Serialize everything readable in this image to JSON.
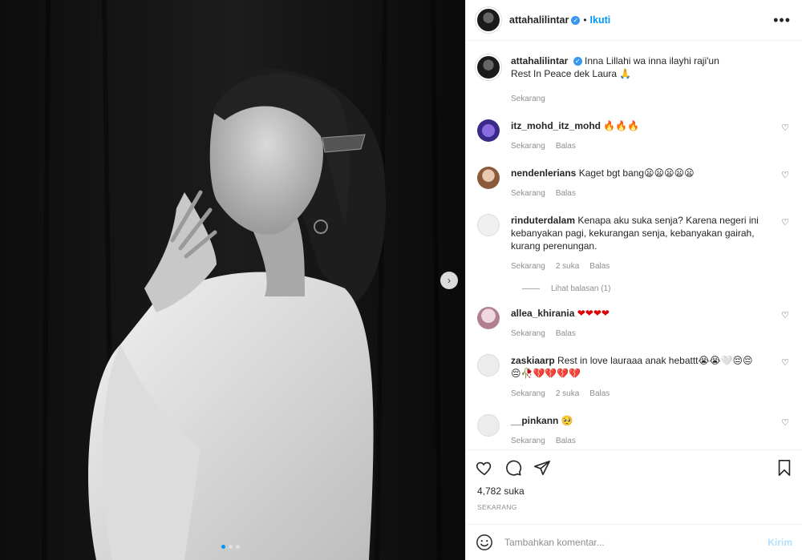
{
  "header": {
    "username": "attahalilintar",
    "follow_label": "Ikuti",
    "separator": "•",
    "more_label": "•••"
  },
  "caption": {
    "username": "attahalilintar",
    "text_line1": "Inna Lillahi wa inna ilayhi raji'un",
    "text_line2": "Rest In Peace dek Laura 🙏",
    "time": "Sekarang"
  },
  "comments": [
    {
      "username": "itz_mohd_itz_mohd",
      "text": "🔥🔥🔥",
      "time": "Sekarang",
      "likes": "",
      "reply": "Balas",
      "avatar_color": "#6a4bd0"
    },
    {
      "username": "nendenlerians",
      "text": "Kaget bgt bang😦😦😦😦😦",
      "time": "Sekarang",
      "likes": "",
      "reply": "Balas",
      "avatar_color": "#c9a27a"
    },
    {
      "username": "rinduterdalam",
      "text": "Kenapa aku suka senja? Karena negeri ini kebanyakan pagi, kekurangan senja, kebanyakan gairah, kurang perenungan.",
      "time": "Sekarang",
      "likes": "2 suka",
      "reply": "Balas",
      "avatar_color": "#e8e8e8",
      "view_replies": "Lihat balasan (1)"
    },
    {
      "username": "allea_khirania",
      "text": "❤❤❤❤",
      "time": "Sekarang",
      "likes": "",
      "reply": "Balas",
      "avatar_color": "#d9b6c9"
    },
    {
      "username": "zaskiaarp",
      "text": "Rest in love lauraaa anak hebattt😭😭🤍😔😔😔🥀💔💔💔💔",
      "time": "Sekarang",
      "likes": "2 suka",
      "reply": "Balas",
      "avatar_color": "#e0e0e0"
    },
    {
      "username": "__pinkann",
      "text": "🥺",
      "time": "Sekarang",
      "likes": "",
      "reply": "Balas",
      "avatar_color": "#e0e0e0"
    }
  ],
  "actions": {
    "likes": "4,782 suka",
    "time": "SEKARANG"
  },
  "add_comment": {
    "placeholder": "Tambahkan komentar...",
    "post_label": "Kirim"
  },
  "carousel": {
    "next_label": "›",
    "slide_count": 3,
    "active_index": 0
  }
}
